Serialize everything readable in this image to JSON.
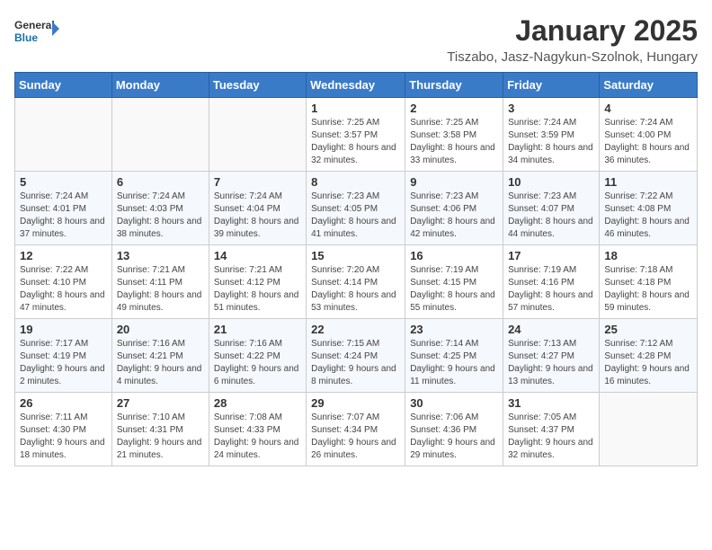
{
  "header": {
    "logo_line1": "General",
    "logo_line2": "Blue",
    "title": "January 2025",
    "subtitle": "Tiszabo, Jasz-Nagykun-Szolnok, Hungary"
  },
  "days_of_week": [
    "Sunday",
    "Monday",
    "Tuesday",
    "Wednesday",
    "Thursday",
    "Friday",
    "Saturday"
  ],
  "weeks": [
    [
      {
        "day": "",
        "info": ""
      },
      {
        "day": "",
        "info": ""
      },
      {
        "day": "",
        "info": ""
      },
      {
        "day": "1",
        "info": "Sunrise: 7:25 AM\nSunset: 3:57 PM\nDaylight: 8 hours and 32 minutes."
      },
      {
        "day": "2",
        "info": "Sunrise: 7:25 AM\nSunset: 3:58 PM\nDaylight: 8 hours and 33 minutes."
      },
      {
        "day": "3",
        "info": "Sunrise: 7:24 AM\nSunset: 3:59 PM\nDaylight: 8 hours and 34 minutes."
      },
      {
        "day": "4",
        "info": "Sunrise: 7:24 AM\nSunset: 4:00 PM\nDaylight: 8 hours and 36 minutes."
      }
    ],
    [
      {
        "day": "5",
        "info": "Sunrise: 7:24 AM\nSunset: 4:01 PM\nDaylight: 8 hours and 37 minutes."
      },
      {
        "day": "6",
        "info": "Sunrise: 7:24 AM\nSunset: 4:03 PM\nDaylight: 8 hours and 38 minutes."
      },
      {
        "day": "7",
        "info": "Sunrise: 7:24 AM\nSunset: 4:04 PM\nDaylight: 8 hours and 39 minutes."
      },
      {
        "day": "8",
        "info": "Sunrise: 7:23 AM\nSunset: 4:05 PM\nDaylight: 8 hours and 41 minutes."
      },
      {
        "day": "9",
        "info": "Sunrise: 7:23 AM\nSunset: 4:06 PM\nDaylight: 8 hours and 42 minutes."
      },
      {
        "day": "10",
        "info": "Sunrise: 7:23 AM\nSunset: 4:07 PM\nDaylight: 8 hours and 44 minutes."
      },
      {
        "day": "11",
        "info": "Sunrise: 7:22 AM\nSunset: 4:08 PM\nDaylight: 8 hours and 46 minutes."
      }
    ],
    [
      {
        "day": "12",
        "info": "Sunrise: 7:22 AM\nSunset: 4:10 PM\nDaylight: 8 hours and 47 minutes."
      },
      {
        "day": "13",
        "info": "Sunrise: 7:21 AM\nSunset: 4:11 PM\nDaylight: 8 hours and 49 minutes."
      },
      {
        "day": "14",
        "info": "Sunrise: 7:21 AM\nSunset: 4:12 PM\nDaylight: 8 hours and 51 minutes."
      },
      {
        "day": "15",
        "info": "Sunrise: 7:20 AM\nSunset: 4:14 PM\nDaylight: 8 hours and 53 minutes."
      },
      {
        "day": "16",
        "info": "Sunrise: 7:19 AM\nSunset: 4:15 PM\nDaylight: 8 hours and 55 minutes."
      },
      {
        "day": "17",
        "info": "Sunrise: 7:19 AM\nSunset: 4:16 PM\nDaylight: 8 hours and 57 minutes."
      },
      {
        "day": "18",
        "info": "Sunrise: 7:18 AM\nSunset: 4:18 PM\nDaylight: 8 hours and 59 minutes."
      }
    ],
    [
      {
        "day": "19",
        "info": "Sunrise: 7:17 AM\nSunset: 4:19 PM\nDaylight: 9 hours and 2 minutes."
      },
      {
        "day": "20",
        "info": "Sunrise: 7:16 AM\nSunset: 4:21 PM\nDaylight: 9 hours and 4 minutes."
      },
      {
        "day": "21",
        "info": "Sunrise: 7:16 AM\nSunset: 4:22 PM\nDaylight: 9 hours and 6 minutes."
      },
      {
        "day": "22",
        "info": "Sunrise: 7:15 AM\nSunset: 4:24 PM\nDaylight: 9 hours and 8 minutes."
      },
      {
        "day": "23",
        "info": "Sunrise: 7:14 AM\nSunset: 4:25 PM\nDaylight: 9 hours and 11 minutes."
      },
      {
        "day": "24",
        "info": "Sunrise: 7:13 AM\nSunset: 4:27 PM\nDaylight: 9 hours and 13 minutes."
      },
      {
        "day": "25",
        "info": "Sunrise: 7:12 AM\nSunset: 4:28 PM\nDaylight: 9 hours and 16 minutes."
      }
    ],
    [
      {
        "day": "26",
        "info": "Sunrise: 7:11 AM\nSunset: 4:30 PM\nDaylight: 9 hours and 18 minutes."
      },
      {
        "day": "27",
        "info": "Sunrise: 7:10 AM\nSunset: 4:31 PM\nDaylight: 9 hours and 21 minutes."
      },
      {
        "day": "28",
        "info": "Sunrise: 7:08 AM\nSunset: 4:33 PM\nDaylight: 9 hours and 24 minutes."
      },
      {
        "day": "29",
        "info": "Sunrise: 7:07 AM\nSunset: 4:34 PM\nDaylight: 9 hours and 26 minutes."
      },
      {
        "day": "30",
        "info": "Sunrise: 7:06 AM\nSunset: 4:36 PM\nDaylight: 9 hours and 29 minutes."
      },
      {
        "day": "31",
        "info": "Sunrise: 7:05 AM\nSunset: 4:37 PM\nDaylight: 9 hours and 32 minutes."
      },
      {
        "day": "",
        "info": ""
      }
    ]
  ]
}
